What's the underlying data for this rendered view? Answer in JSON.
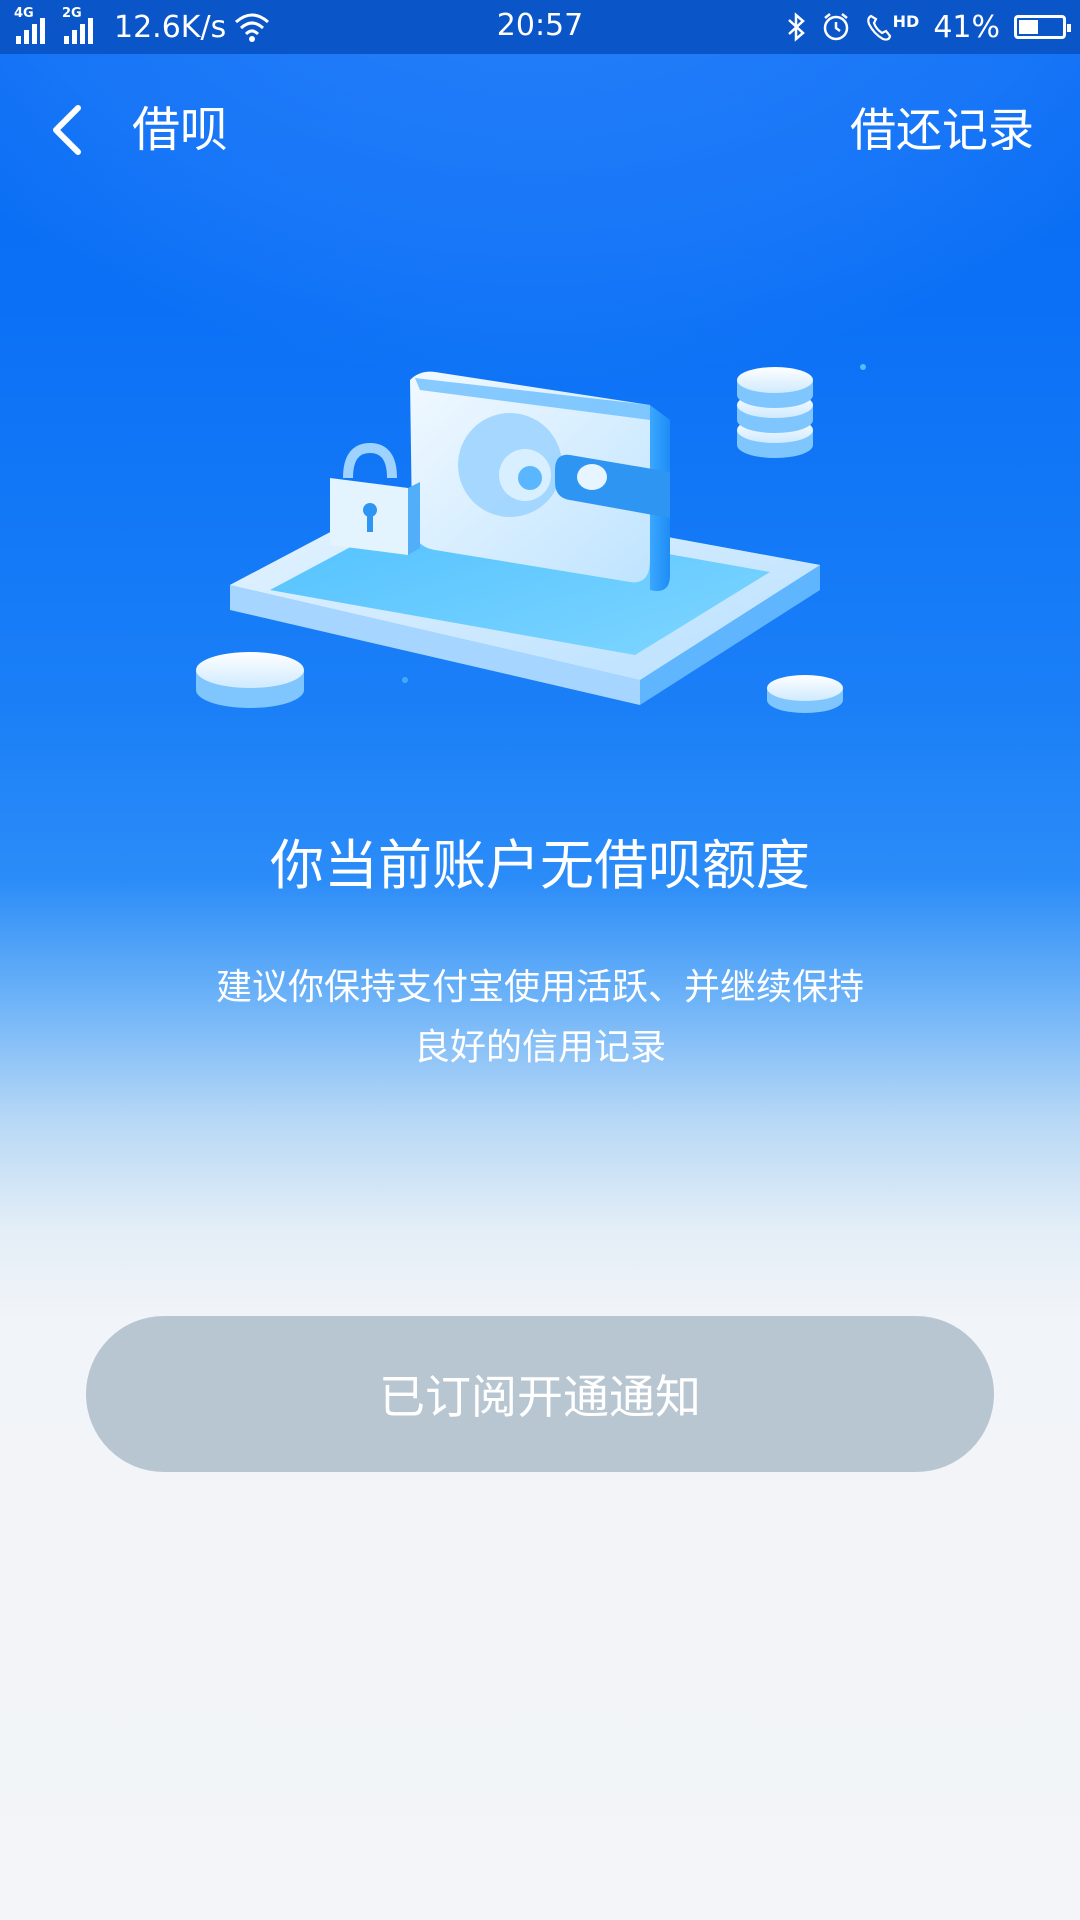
{
  "status_bar": {
    "net1": "4G",
    "net2": "2G",
    "speed": "12.6K/s",
    "time": "20:57",
    "hd": "HD",
    "battery_text": "41%",
    "battery_level": 0.41,
    "icons": [
      "signal-icon",
      "wifi-icon",
      "bluetooth-icon",
      "alarm-icon",
      "hd-call-icon",
      "battery-icon"
    ]
  },
  "header": {
    "title": "借呗",
    "action": "借还记录",
    "back_icon": "chevron-left-icon"
  },
  "main": {
    "illustration": "wallet-tablet-lock-coins",
    "headline": "你当前账户无借呗额度",
    "desc_line1": "建议你保持支付宝使用活跃、并继续保持",
    "desc_line2": "良好的信用记录",
    "subscribe_button": "已订阅开通通知"
  },
  "colors": {
    "primary_blue": "#0a6cf3",
    "status_bar": "#0a55c8",
    "button_disabled": "#b8c6d2",
    "background_light": "#f3f5f8"
  }
}
